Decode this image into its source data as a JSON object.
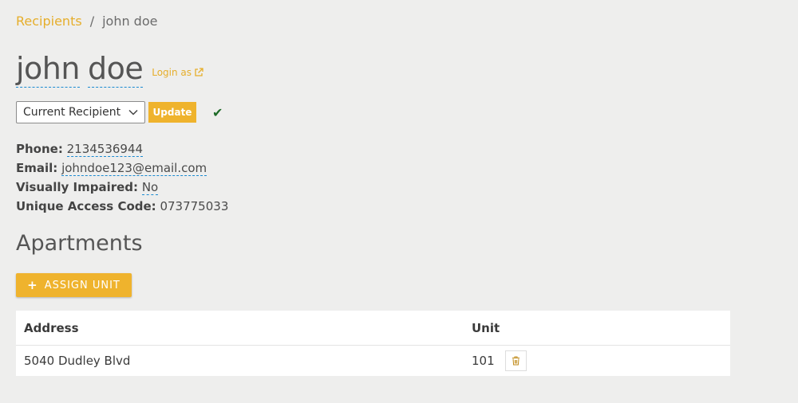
{
  "breadcrumb": {
    "parent": "Recipients",
    "separator": "/",
    "current": "john doe"
  },
  "recipient": {
    "first_name": "john",
    "last_name": "doe",
    "login_as": "Login as"
  },
  "status": {
    "selected": "Current Recipient",
    "update_label": "Update",
    "check": "✔"
  },
  "details": {
    "phone_label": "Phone:",
    "phone": "2134536944",
    "email_label": "Email:",
    "email": "johndoe123@email.com",
    "impaired_label": "Visually Impaired:",
    "impaired": "No",
    "code_label": "Unique Access Code:",
    "code": "073775033"
  },
  "apartments": {
    "title": "Apartments",
    "assign_label": "ASSIGN UNIT",
    "assign_icon": "+",
    "columns": [
      "Address",
      "Unit"
    ],
    "rows": [
      {
        "address": "5040 Dudley Blvd",
        "unit": "101"
      }
    ]
  },
  "colors": {
    "accent": "#efb32d",
    "link": "#e6ae2b",
    "dashed_underline": "#1a8ad1",
    "check": "#1e6b28"
  }
}
